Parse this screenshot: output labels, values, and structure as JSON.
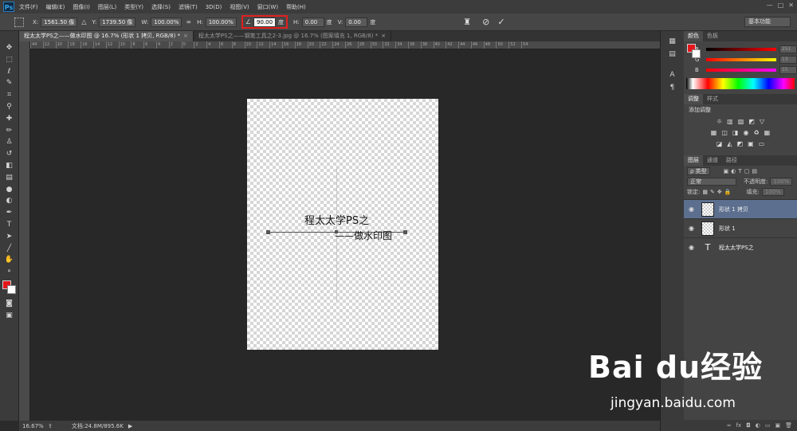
{
  "app": {
    "logo": "Ps",
    "menus": [
      "文件(F)",
      "编辑(E)",
      "图像(I)",
      "图层(L)",
      "类型(Y)",
      "选择(S)",
      "滤镜(T)",
      "3D(D)",
      "视图(V)",
      "窗口(W)",
      "帮助(H)"
    ],
    "window_controls": [
      "—",
      "□",
      "✕"
    ]
  },
  "options_bar": {
    "x_label": "X:",
    "x_value": "1561.50 像",
    "y_label": "Y:",
    "y_value": "1739.50 像",
    "w_label": "W:",
    "w_value": "100.00%",
    "h_label": "H:",
    "h_value": "100.00%",
    "angle_value": "90.00",
    "angle_unit": "度",
    "hskew_label": "H:",
    "hskew_value": "0.00",
    "hskew_unit": "度",
    "vskew_label": "V:",
    "vskew_value": "0.00",
    "vskew_unit": "度",
    "workspace": "基本功能"
  },
  "tabs": [
    {
      "label": "程太太学PS之——做水印图 @ 16.7% (形状 1 拷贝, RGB/8) *",
      "close": "×"
    },
    {
      "label": "程太太学PS之——钢笔工具之2-3.jpg @ 16.7% (图案填充 1, RGB/8) *",
      "close": "×"
    }
  ],
  "ruler_ticks": [
    "44",
    "22",
    "20",
    "18",
    "16",
    "14",
    "12",
    "10",
    "8",
    "6",
    "4",
    "2",
    "0",
    "2",
    "4",
    "6",
    "8",
    "10",
    "12",
    "14",
    "16",
    "18",
    "20",
    "22",
    "24",
    "26",
    "28",
    "30",
    "32",
    "34",
    "36",
    "38",
    "40",
    "42",
    "44",
    "46",
    "48",
    "50",
    "52",
    "54"
  ],
  "canvas": {
    "text1": "程太太学PS之",
    "text2": "——做水印图"
  },
  "status": {
    "zoom": "16.67%",
    "doc": "文档:24.8M/895.6K",
    "arrow": "▶"
  },
  "color_panel": {
    "tabs": [
      "颜色",
      "色板"
    ],
    "r_label": "R",
    "r_value": "251",
    "g_label": "G",
    "g_value": "13",
    "b_label": "B",
    "b_value": "15"
  },
  "adjust_panel": {
    "tabs": [
      "调整",
      "样式"
    ],
    "title": "添加调整"
  },
  "layers_panel": {
    "tabs": [
      "图层",
      "通道",
      "路径"
    ],
    "kind": "ρ 类型",
    "mode": "正常",
    "opacity_label": "不透明度:",
    "opacity_value": "100%",
    "lock_label": "锁定:",
    "fill_label": "填充:",
    "fill_value": "100%",
    "layers": [
      {
        "name": "形状 1 拷贝",
        "type": "shape",
        "selected": true
      },
      {
        "name": "形状 1",
        "type": "shape",
        "selected": false
      },
      {
        "name": "程太太学PS之",
        "type": "text",
        "selected": false
      }
    ]
  },
  "watermark": {
    "brand": "Bai du经验",
    "url": "jingyan.baidu.com"
  }
}
